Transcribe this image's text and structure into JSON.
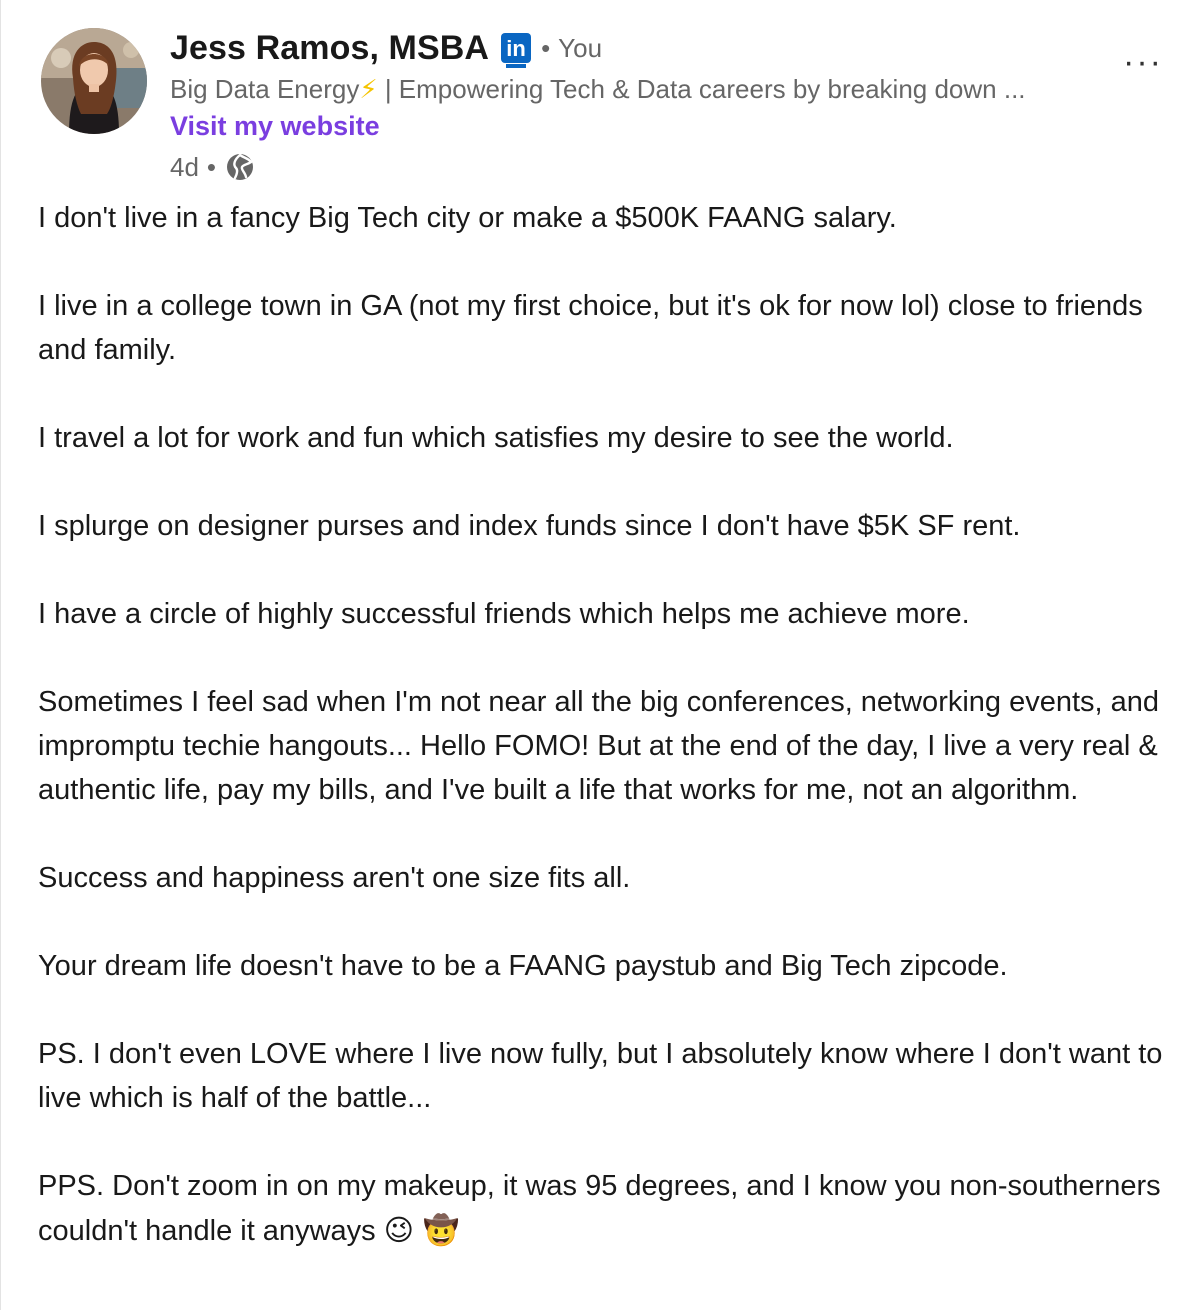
{
  "post": {
    "author_name": "Jess Ramos, MSBA",
    "linkedin_badge": "in",
    "separator": "•",
    "relation": "You",
    "headline_part1": "Big Data Energy",
    "headline_bolt": "⚡",
    "headline_part2": " | Empowering Tech & Data careers by breaking down ...",
    "website_link": "Visit my website",
    "age": "4d",
    "visibility_icon": "globe-icon",
    "more_menu": "···",
    "paragraphs": [
      "I don't live in a fancy Big Tech city or make a $500K FAANG salary.",
      "I live in a college town in GA (not my first choice, but it's ok for now lol) close to friends and family.",
      "I travel a lot for work and fun which satisfies my desire to see the world.",
      "I splurge on designer purses and index funds since I don't have $5K SF rent.",
      "I have a circle of highly successful friends which helps me achieve more.",
      "Sometimes I feel sad when I'm not near all the big conferences, networking events, and impromptu techie hangouts... Hello FOMO! But at the end of the day, I live a very real & authentic life, pay my bills, and I've built a life that works for me, not an algorithm.",
      "Success and happiness aren't one size fits all.",
      "Your dream life doesn't have to be a FAANG paystub and Big Tech zipcode.",
      "PS. I don't even LOVE where I live now fully, but I absolutely know where I don't want to live which is half of the battle...",
      "PPS. Don't zoom in on my makeup, it was 95 degrees, and I know you non-southerners couldn't handle it anyways"
    ],
    "closing_emojis": "😉 🤠"
  },
  "colors": {
    "accent_link": "#7a3ee0",
    "linkedin_blue": "#0a66c2",
    "muted_text": "#666666",
    "body_text": "#191919"
  }
}
